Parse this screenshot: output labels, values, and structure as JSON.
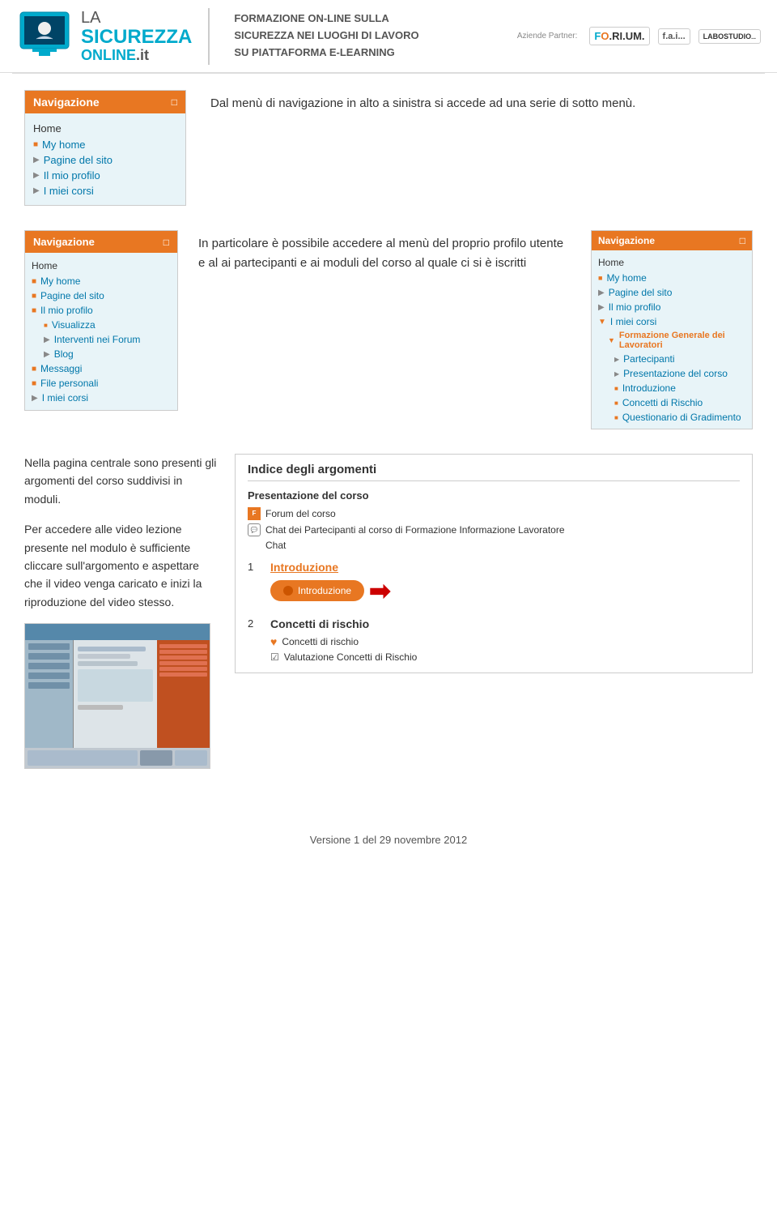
{
  "header": {
    "logo_la": "LA",
    "logo_sicurezza": "SICUREZZA",
    "logo_online": "ONLINE",
    "logo_it": ".it",
    "tagline_line1": "FORMAZIONE ON-LINE SULLA",
    "tagline_line2": "SICUREZZA NEI LUOGHI DI LAVORO",
    "tagline_line3": "SU PIATTAFORMA E-LEARNING",
    "partner_label": "Aziende Partner:",
    "partner1": "FO.RI.UM.",
    "partner2": "f.a.i...",
    "partner3": "LABOSTUDIO..."
  },
  "section1": {
    "text": "Dal menù di navigazione in alto a sinistra si accede ad una serie di sotto menù."
  },
  "section2": {
    "text": "In particolare è possibile accedere al menù del proprio profilo utente e al ai partecipanti    e ai moduli del corso al quale ci si è iscritti"
  },
  "section3": {
    "left_heading": "Nella pagina centrale sono presenti gli argomenti del corso suddivisi in moduli.",
    "left_text": "Per  accedere  alle  video  lezione presente  nel  modulo  è  sufficiente cliccare sull'argomento e aspettare che il  video  venga  caricato  e  inizi  la riproduzione del video stesso."
  },
  "nav1": {
    "header": "Navigazione",
    "home": "Home",
    "items": [
      {
        "label": "My home",
        "type": "bullet"
      },
      {
        "label": "Pagine del sito",
        "type": "arrow"
      },
      {
        "label": "Il mio profilo",
        "type": "arrow"
      },
      {
        "label": "I miei corsi",
        "type": "arrow"
      }
    ]
  },
  "nav2": {
    "header": "Navigazione",
    "home": "Home",
    "items": [
      {
        "label": "My home",
        "type": "bullet"
      },
      {
        "label": "Pagine del sito",
        "type": "bullet"
      },
      {
        "label": "Il mio profilo",
        "type": "bullet"
      },
      {
        "label": "Visualizza",
        "type": "sub-bullet",
        "indent": 1
      },
      {
        "label": "Interventi nei Forum",
        "type": "arrow",
        "indent": 1
      },
      {
        "label": "Blog",
        "type": "arrow",
        "indent": 1
      },
      {
        "label": "Messaggi",
        "type": "bullet"
      },
      {
        "label": "File personali",
        "type": "bullet"
      },
      {
        "label": "I miei corsi",
        "type": "arrow"
      }
    ]
  },
  "nav3": {
    "header": "Navigazione",
    "home": "Home",
    "items": [
      {
        "label": "My home",
        "type": "bullet"
      },
      {
        "label": "Pagine del sito",
        "type": "arrow"
      },
      {
        "label": "Il mio profilo",
        "type": "arrow"
      },
      {
        "label": "I miei corsi",
        "type": "arrow-down"
      },
      {
        "label": "Formazione Generale dei Lavoratori",
        "type": "bold",
        "indent": 1
      },
      {
        "label": "Partecipanti",
        "type": "arrow",
        "indent": 2
      },
      {
        "label": "Presentazione del corso",
        "type": "arrow",
        "indent": 2
      },
      {
        "label": "Introduzione",
        "type": "bullet",
        "indent": 2
      },
      {
        "label": "Concetti di Rischio",
        "type": "bullet",
        "indent": 2
      },
      {
        "label": "Questionario di Gradimento",
        "type": "bullet",
        "indent": 2
      }
    ]
  },
  "indice": {
    "title": "Indice degli argomenti",
    "section1_title": "Presentazione del corso",
    "item1": "Forum del corso",
    "item2": "Chat dei Partecipanti al corso di Formazione Informazione Lavoratore",
    "item3": "Chat",
    "section2_number": "1",
    "section2_title": "Introduzione",
    "introduzione_btn": "Introduzione",
    "section3_number": "2",
    "section3_title": "Concetti di rischio",
    "concetti_item1": "Concetti di rischio",
    "concetti_item2": "Valutazione Concetti di Rischio"
  },
  "footer": {
    "text": "Versione 1 del 29 novembre 2012"
  }
}
